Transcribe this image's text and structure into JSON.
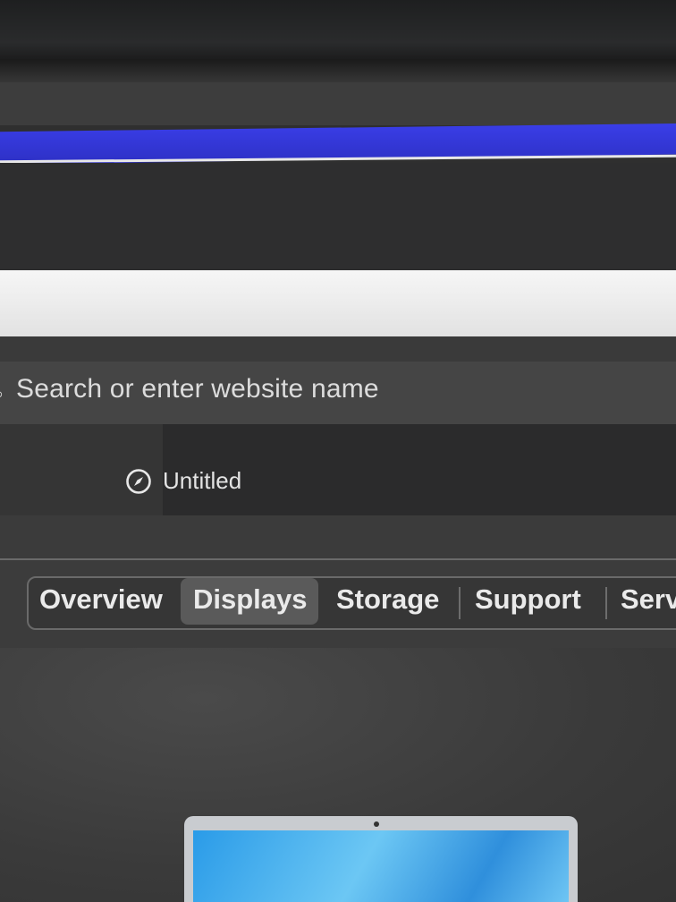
{
  "address_bar": {
    "placeholder": "Search or enter website name"
  },
  "tab": {
    "title": "Untitled",
    "icon": "compass-icon"
  },
  "segments": {
    "items": [
      "Overview",
      "Displays",
      "Storage",
      "Support",
      "Serv"
    ],
    "selected": "Displays"
  },
  "colors": {
    "accent_bar": "#3a3ee8",
    "background": "#2f2f2f"
  }
}
